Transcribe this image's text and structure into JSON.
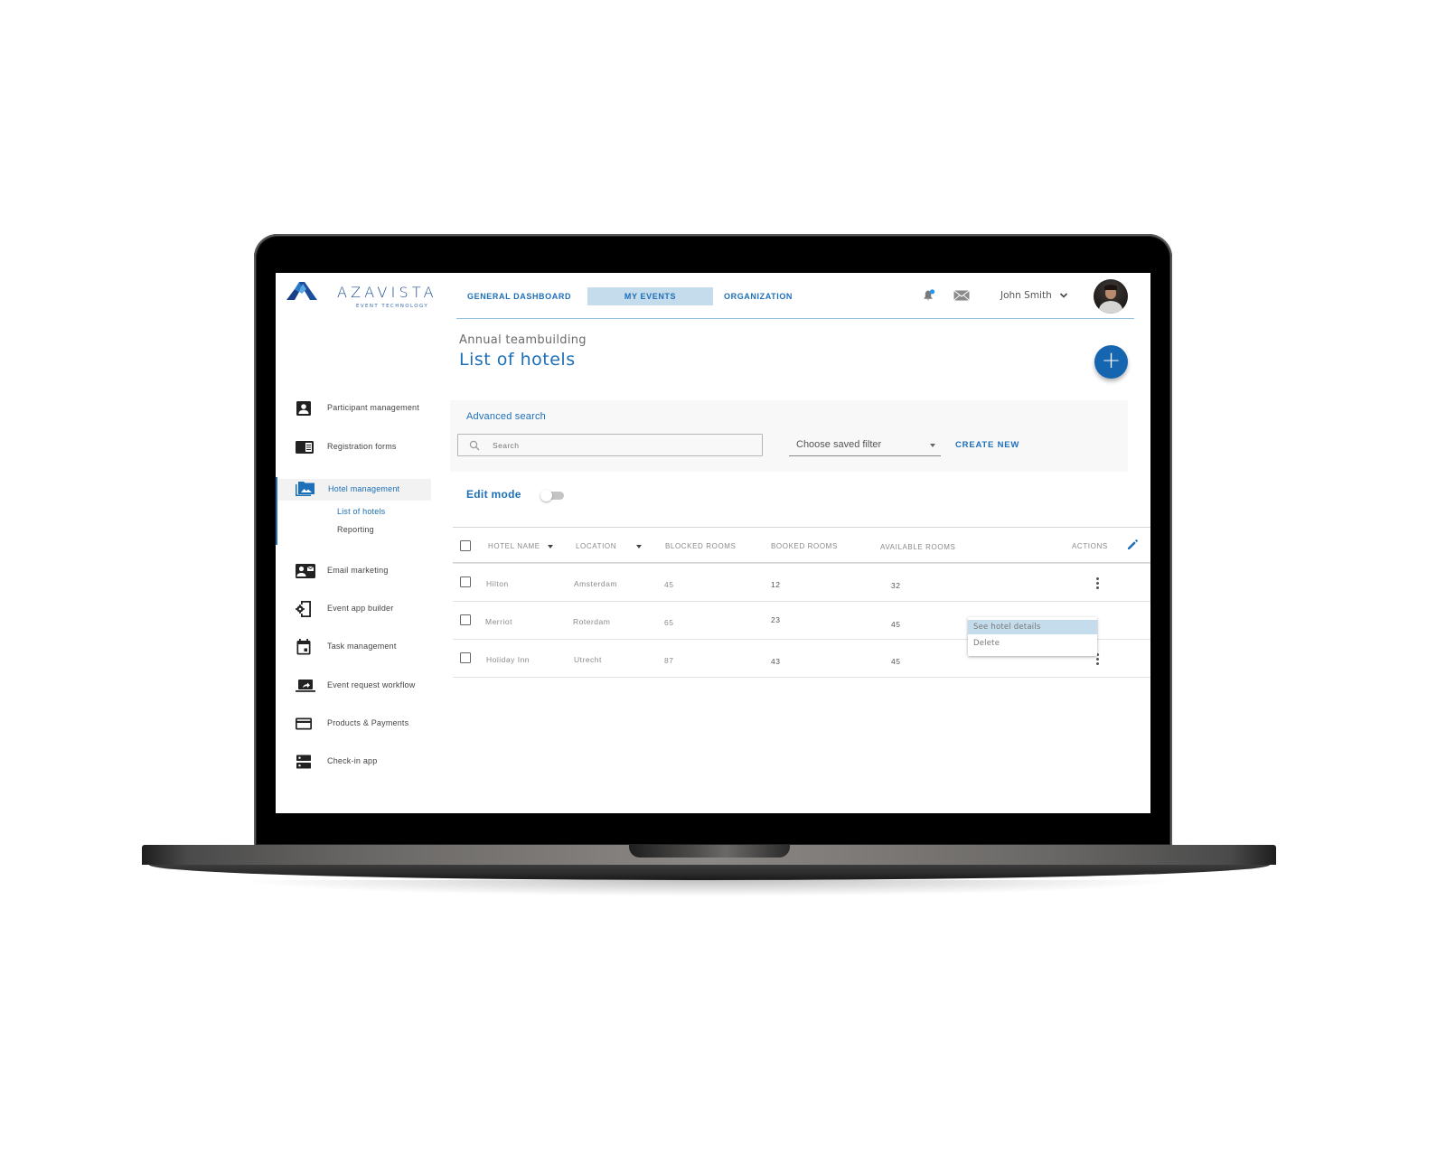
{
  "brand": {
    "name": "AZAVISTA",
    "tagline": "EVENT TECHNOLOGY",
    "accent_color": "#1d6fb8"
  },
  "topnav": {
    "tabs": [
      {
        "label": "GENERAL DASHBOARD",
        "active": false
      },
      {
        "label": "MY EVENTS",
        "active": true
      },
      {
        "label": "ORGANIZATION",
        "active": false
      }
    ],
    "notification_icon": "bell-icon",
    "mail_icon": "mail-icon",
    "user_name": "John Smith",
    "user_menu_icon": "chevron-down-icon"
  },
  "header": {
    "event_name": "Annual teambuilding",
    "page_title": "List of hotels",
    "add_button": "+"
  },
  "sidebar": {
    "items": [
      {
        "label": "Participant management",
        "icon": "account-box-icon"
      },
      {
        "label": "Registration forms",
        "icon": "form-icon"
      },
      {
        "label": "Hotel management",
        "icon": "photo-folder-icon",
        "active": true,
        "children": [
          {
            "label": "List of hotels",
            "active": true
          },
          {
            "label": "Reporting",
            "active": false
          }
        ]
      },
      {
        "label": "Email marketing",
        "icon": "contact-mail-icon"
      },
      {
        "label": "Event app builder",
        "icon": "app-settings-icon"
      },
      {
        "label": "Task management",
        "icon": "calendar-icon"
      },
      {
        "label": "Event request workflow",
        "icon": "laptop-share-icon"
      },
      {
        "label": "Products & Payments",
        "icon": "credit-card-icon"
      },
      {
        "label": "Check-in app",
        "icon": "dns-icon"
      }
    ]
  },
  "search": {
    "advanced_label": "Advanced search",
    "placeholder": "Search",
    "saved_filter": "Choose saved filter",
    "create_new": "CREATE NEW"
  },
  "edit_mode": {
    "label": "Edit mode",
    "enabled": false
  },
  "table": {
    "columns": [
      "HOTEL NAME",
      "LOCATION",
      "BLOCKED ROOMS",
      "BOOKED ROOMS",
      "AVAILABLE ROOMS",
      "ACTIONS"
    ],
    "rows": [
      {
        "hotel": "Hilton",
        "location": "Amsterdam",
        "blocked": "45",
        "booked": "12",
        "available": "32"
      },
      {
        "hotel": "Merriot",
        "location": "Roterdam",
        "blocked": "65",
        "booked": "23",
        "available": "45"
      },
      {
        "hotel": "Holiday Inn",
        "location": "Utrecht",
        "blocked": "87",
        "booked": "43",
        "available": "45"
      }
    ]
  },
  "context_menu": {
    "items": [
      {
        "label": "See hotel details",
        "highlighted": true
      },
      {
        "label": "Delete",
        "highlighted": false
      }
    ]
  }
}
